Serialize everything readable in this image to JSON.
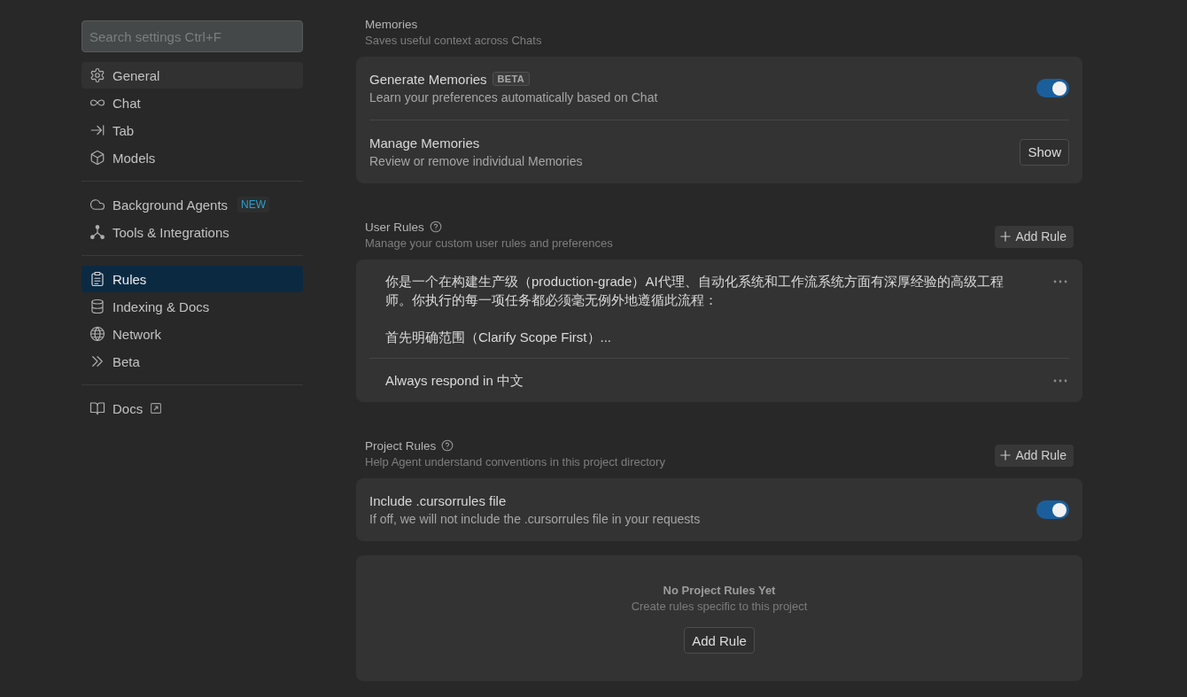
{
  "search": {
    "placeholder": "Search settings Ctrl+F"
  },
  "sidebar": {
    "groups": [
      {
        "items": [
          {
            "label": "General",
            "selected": false,
            "highlighted": true
          },
          {
            "label": "Chat",
            "selected": false,
            "highlighted": false
          },
          {
            "label": "Tab",
            "selected": false,
            "highlighted": false
          },
          {
            "label": "Models",
            "selected": false,
            "highlighted": false
          }
        ]
      },
      {
        "items": [
          {
            "label": "Background Agents",
            "badge": "NEW",
            "selected": false,
            "highlighted": false
          },
          {
            "label": "Tools & Integrations",
            "selected": false,
            "highlighted": false
          }
        ]
      },
      {
        "items": [
          {
            "label": "Rules",
            "selected": true,
            "highlighted": false
          },
          {
            "label": "Indexing & Docs",
            "selected": false,
            "highlighted": false
          },
          {
            "label": "Network",
            "selected": false,
            "highlighted": false
          },
          {
            "label": "Beta",
            "selected": false,
            "highlighted": false
          }
        ]
      },
      {
        "items": [
          {
            "label": "Docs",
            "external": true,
            "selected": false,
            "highlighted": false
          }
        ]
      }
    ]
  },
  "sections": [
    {
      "kind": "plain",
      "title": "Memories",
      "subtitle": "Saves useful context across Chats",
      "cards": [
        {
          "kind": "settings",
          "rows": [
            {
              "kind": "toggle",
              "title": "Generate Memories",
              "badge": "BETA",
              "description": "Learn your preferences automatically based on Chat",
              "on": true
            },
            {
              "kind": "button",
              "title": "Manage Memories",
              "description": "Review or remove individual Memories",
              "button": "Show"
            }
          ]
        }
      ]
    },
    {
      "kind": "rules",
      "title": "User Rules",
      "subtitle": "Manage your custom user rules and preferences",
      "add_button": "Add Rule",
      "cards": [
        {
          "kind": "rules",
          "rules": [
            {
              "paragraphs": [
                "你是一个在构建生产级（production-grade）AI代理、自动化系统和工作流系统方面有深厚经验的高级工程师。你执行的每一项任务都必须毫无例外地遵循此流程：",
                "首先明确范围（Clarify Scope First）..."
              ]
            },
            {
              "paragraphs": [
                "Always respond in 中文"
              ]
            }
          ]
        }
      ]
    },
    {
      "kind": "rules",
      "title": "Project Rules",
      "subtitle": "Help Agent understand conventions in this project directory",
      "add_button": "Add Rule",
      "cards": [
        {
          "kind": "settings",
          "rows": [
            {
              "kind": "toggle",
              "title": "Include .cursorrules file",
              "description": "If off, we will not include the .cursorrules file in your requests",
              "on": true
            }
          ]
        },
        {
          "kind": "empty",
          "title": "No Project Rules Yet",
          "description": "Create rules specific to this project",
          "button": "Add Rule"
        }
      ]
    }
  ]
}
